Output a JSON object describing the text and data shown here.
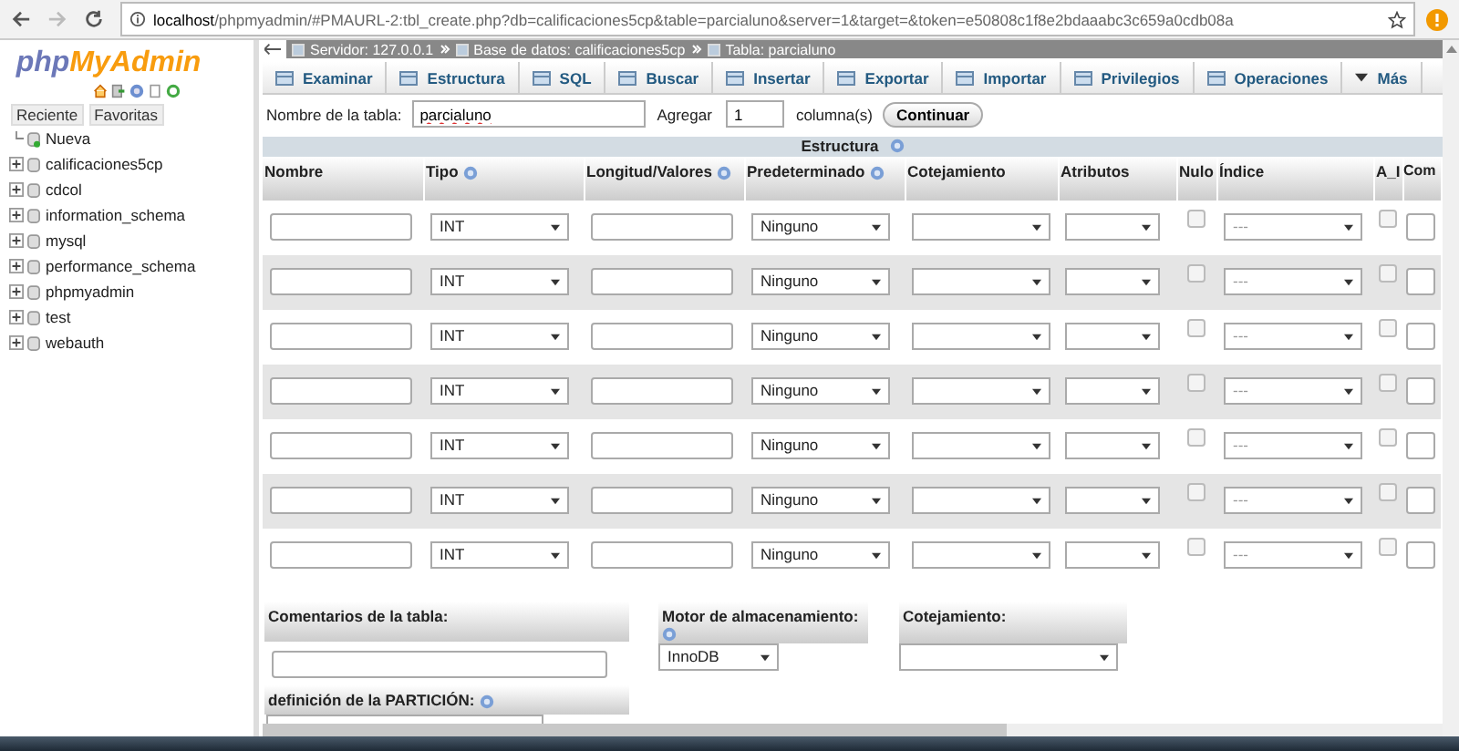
{
  "browser": {
    "url_host": "localhost",
    "url_path": "/phpmyadmin/#PMAURL-2:tbl_create.php?db=calificaciones5cp&table=parcialuno&server=1&target=&token=e50808c1f8e2bdaaabc3c659a0cdb08a"
  },
  "sidebar": {
    "logo": {
      "part_1": "php",
      "part_2": "MyAdmin"
    },
    "tabs": [
      {
        "label": "Reciente"
      },
      {
        "label": "Favoritas"
      }
    ],
    "tree": [
      {
        "label": "Nueva",
        "kind": "new"
      },
      {
        "label": "calificaciones5cp",
        "kind": "db"
      },
      {
        "label": "cdcol",
        "kind": "db"
      },
      {
        "label": "information_schema",
        "kind": "db"
      },
      {
        "label": "mysql",
        "kind": "db"
      },
      {
        "label": "performance_schema",
        "kind": "db"
      },
      {
        "label": "phpmyadmin",
        "kind": "db"
      },
      {
        "label": "test",
        "kind": "db"
      },
      {
        "label": "webauth",
        "kind": "db"
      }
    ]
  },
  "breadcrumb": [
    "Servidor: 127.0.0.1",
    "Base de datos: calificaciones5cp",
    "Tabla: parcialuno"
  ],
  "tabs": [
    {
      "label": "Examinar",
      "kind": "page",
      "selected": false
    },
    {
      "label": "Estructura",
      "kind": "page",
      "selected": false
    },
    {
      "label": "SQL",
      "kind": "page",
      "selected": false
    },
    {
      "label": "Buscar",
      "kind": "page",
      "selected": false
    },
    {
      "label": "Insertar",
      "kind": "page",
      "selected": false
    },
    {
      "label": "Exportar",
      "kind": "page",
      "selected": false
    },
    {
      "label": "Importar",
      "kind": "page",
      "selected": false
    },
    {
      "label": "Privilegios",
      "kind": "page",
      "selected": false
    },
    {
      "label": "Operaciones",
      "kind": "page",
      "selected": false
    },
    {
      "label": "Más",
      "kind": "menu",
      "selected": false
    }
  ],
  "table_name": {
    "label": "Nombre de la tabla:",
    "value": "parcialuno",
    "add_label": "Agregar",
    "add_value": "1",
    "add_unit": "columna(s)",
    "button": "Continuar"
  },
  "structure": {
    "title": "Estructura",
    "columns": [
      {
        "label": "Nombre",
        "help": false
      },
      {
        "label": "Tipo",
        "help": true
      },
      {
        "label": "Longitud/Valores",
        "help": true
      },
      {
        "label": "Predeterminado",
        "help": true
      },
      {
        "label": "Cotejamiento",
        "help": false
      },
      {
        "label": "Atributos",
        "help": false
      },
      {
        "label": "Nulo",
        "help": false
      },
      {
        "label": "Índice",
        "help": false
      },
      {
        "label": "A_I",
        "help": false
      },
      {
        "label": "Com",
        "help": false
      }
    ],
    "rows": [
      {
        "type": "INT",
        "default": "Ninguno",
        "index": "---",
        "null": false,
        "ai": false
      },
      {
        "type": "INT",
        "default": "Ninguno",
        "index": "---",
        "null": false,
        "ai": false
      },
      {
        "type": "INT",
        "default": "Ninguno",
        "index": "---",
        "null": false,
        "ai": false
      },
      {
        "type": "INT",
        "default": "Ninguno",
        "index": "---",
        "null": false,
        "ai": false
      },
      {
        "type": "INT",
        "default": "Ninguno",
        "index": "---",
        "null": false,
        "ai": false
      },
      {
        "type": "INT",
        "default": "Ninguno",
        "index": "---",
        "null": false,
        "ai": false
      },
      {
        "type": "INT",
        "default": "Ninguno",
        "index": "---",
        "null": false,
        "ai": false
      }
    ]
  },
  "options": {
    "comments_label": "Comentarios de la tabla:",
    "engine_label": "Motor de almacenamiento:",
    "engine_value": "InnoDB",
    "collation_label": "Cotejamiento:",
    "partition_label": "definición de la PARTICIÓN:"
  }
}
